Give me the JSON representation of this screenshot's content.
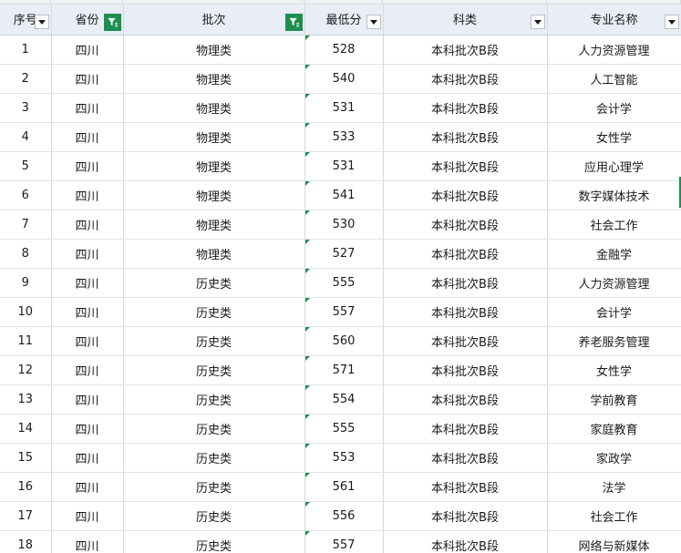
{
  "columns": [
    {
      "label": "序号",
      "filter": "none"
    },
    {
      "label": "省份",
      "filter": "active"
    },
    {
      "label": "批次",
      "filter": "active"
    },
    {
      "label": "最低分",
      "filter": "none"
    },
    {
      "label": "科类",
      "filter": "none"
    },
    {
      "label": "专业名称",
      "filter": "none"
    }
  ],
  "rows": [
    {
      "no": "1",
      "province": "四川",
      "batch": "物理类",
      "min_score": "528",
      "category": "本科批次B段",
      "major": "人力资源管理"
    },
    {
      "no": "2",
      "province": "四川",
      "batch": "物理类",
      "min_score": "540",
      "category": "本科批次B段",
      "major": "人工智能"
    },
    {
      "no": "3",
      "province": "四川",
      "batch": "物理类",
      "min_score": "531",
      "category": "本科批次B段",
      "major": "会计学"
    },
    {
      "no": "4",
      "province": "四川",
      "batch": "物理类",
      "min_score": "533",
      "category": "本科批次B段",
      "major": "女性学"
    },
    {
      "no": "5",
      "province": "四川",
      "batch": "物理类",
      "min_score": "531",
      "category": "本科批次B段",
      "major": "应用心理学"
    },
    {
      "no": "6",
      "province": "四川",
      "batch": "物理类",
      "min_score": "541",
      "category": "本科批次B段",
      "major": "数字媒体技术"
    },
    {
      "no": "7",
      "province": "四川",
      "batch": "物理类",
      "min_score": "530",
      "category": "本科批次B段",
      "major": "社会工作"
    },
    {
      "no": "8",
      "province": "四川",
      "batch": "物理类",
      "min_score": "527",
      "category": "本科批次B段",
      "major": "金融学"
    },
    {
      "no": "9",
      "province": "四川",
      "batch": "历史类",
      "min_score": "555",
      "category": "本科批次B段",
      "major": "人力资源管理"
    },
    {
      "no": "10",
      "province": "四川",
      "batch": "历史类",
      "min_score": "557",
      "category": "本科批次B段",
      "major": "会计学"
    },
    {
      "no": "11",
      "province": "四川",
      "batch": "历史类",
      "min_score": "560",
      "category": "本科批次B段",
      "major": "养老服务管理"
    },
    {
      "no": "12",
      "province": "四川",
      "batch": "历史类",
      "min_score": "571",
      "category": "本科批次B段",
      "major": "女性学"
    },
    {
      "no": "13",
      "province": "四川",
      "batch": "历史类",
      "min_score": "554",
      "category": "本科批次B段",
      "major": "学前教育"
    },
    {
      "no": "14",
      "province": "四川",
      "batch": "历史类",
      "min_score": "555",
      "category": "本科批次B段",
      "major": "家庭教育"
    },
    {
      "no": "15",
      "province": "四川",
      "batch": "历史类",
      "min_score": "553",
      "category": "本科批次B段",
      "major": "家政学"
    },
    {
      "no": "16",
      "province": "四川",
      "batch": "历史类",
      "min_score": "561",
      "category": "本科批次B段",
      "major": "法学"
    },
    {
      "no": "17",
      "province": "四川",
      "batch": "历史类",
      "min_score": "556",
      "category": "本科批次B段",
      "major": "社会工作"
    },
    {
      "no": "18",
      "province": "四川",
      "batch": "历史类",
      "min_score": "557",
      "category": "本科批次B段",
      "major": "网络与新媒体"
    }
  ],
  "colors": {
    "header_bg": "#e9eef6",
    "filter_active": "#1e8f4e",
    "grid": "#d9d9d9"
  }
}
